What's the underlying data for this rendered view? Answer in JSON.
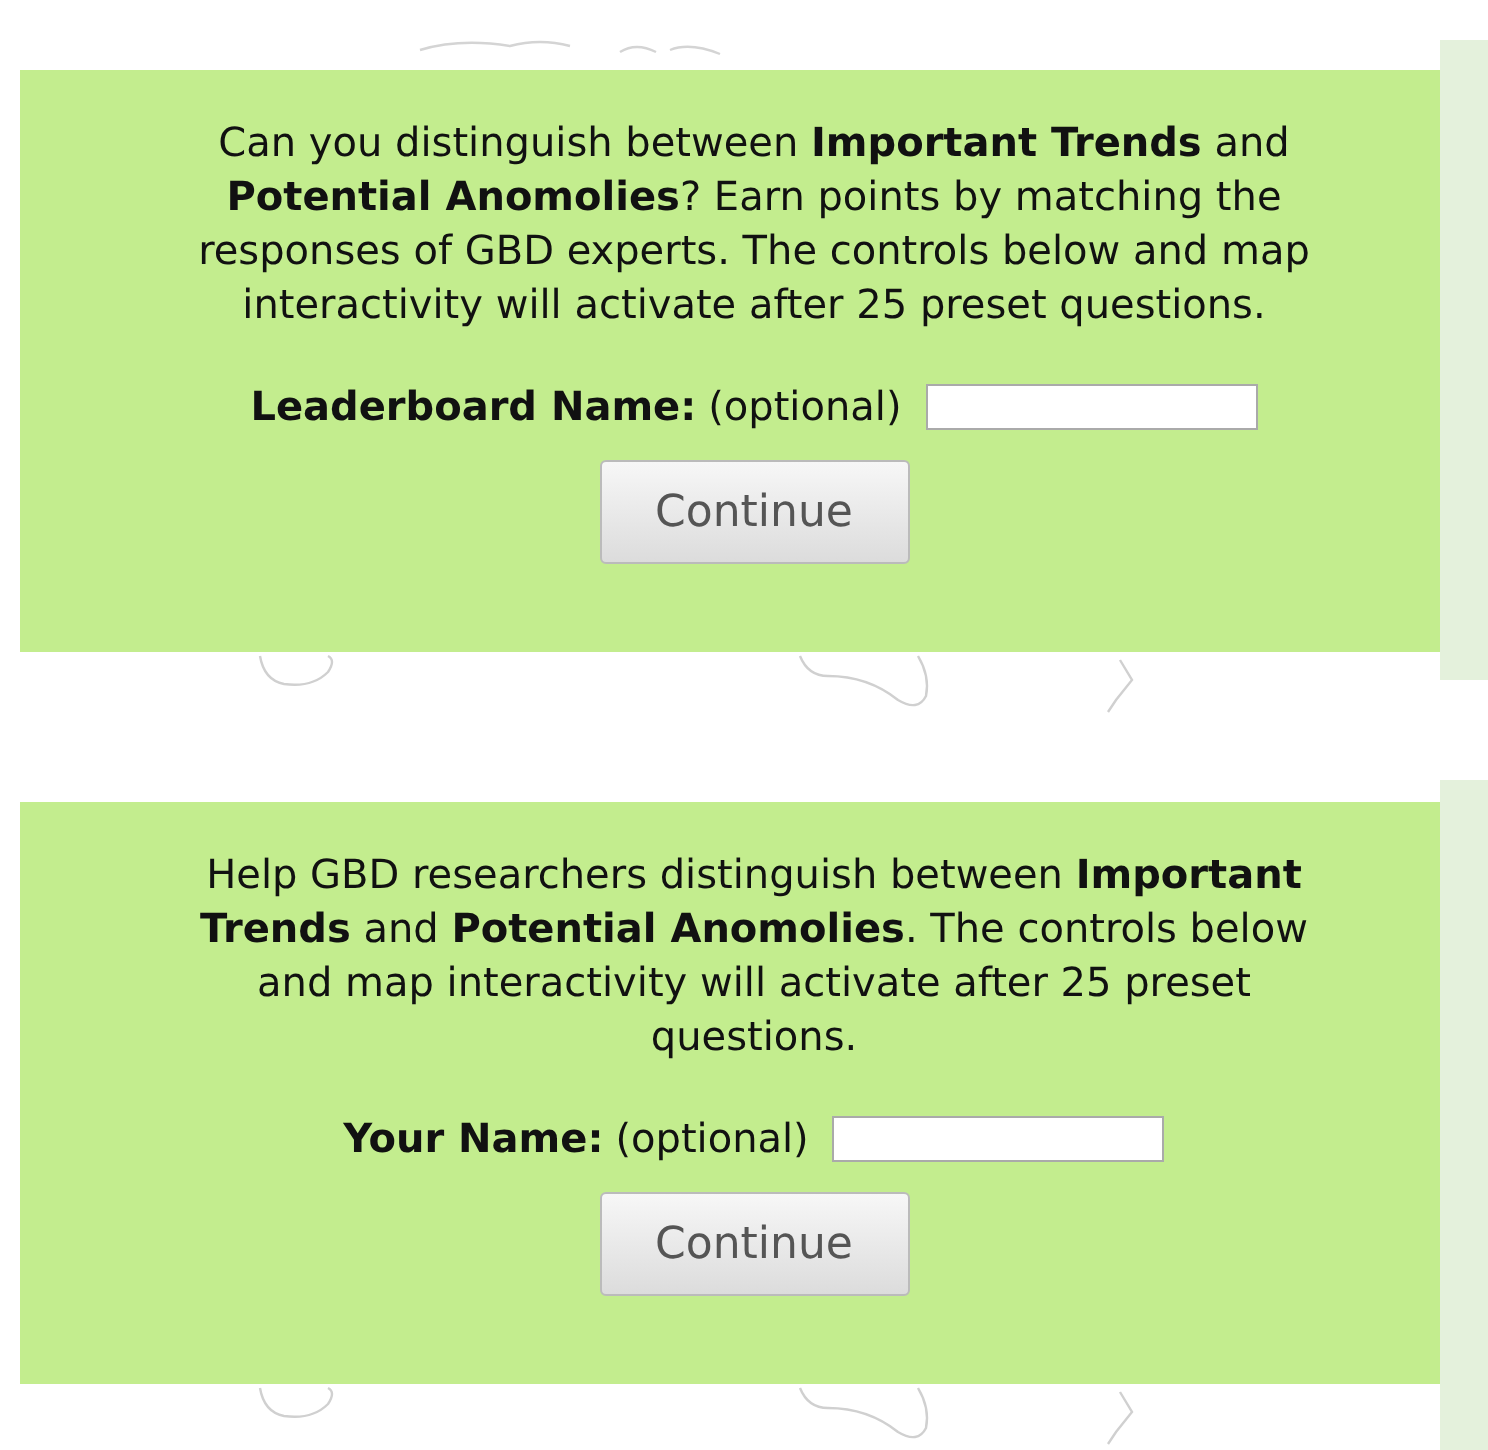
{
  "panels": [
    {
      "intro": "Can you distinguish between **Important Trends** and **Potential Anomolies**? Earn points by matching the responses of GBD experts. The controls below and map interactivity will activate after 25 preset questions.",
      "name_label": "Leaderboard Name:",
      "optional_label": "(optional)",
      "button": "Continue"
    },
    {
      "intro": "Help GBD researchers distinguish between **Important Trends** and **Potential Anomolies**. The controls below and map interactivity will activate after 25 preset questions.",
      "name_label": "Your Name:",
      "optional_label": "(optional)",
      "button": "Continue"
    }
  ]
}
